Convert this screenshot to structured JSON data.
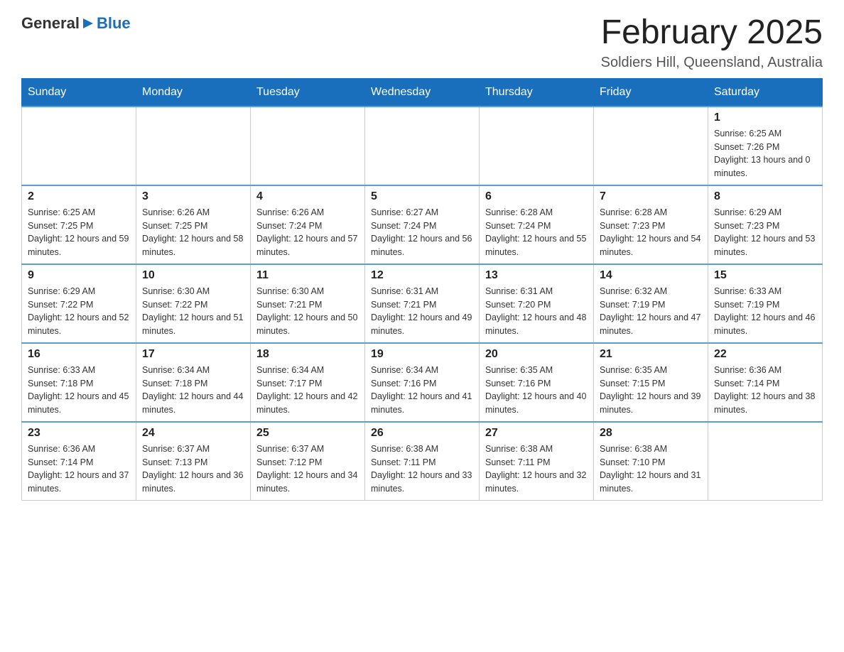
{
  "header": {
    "logo": {
      "general": "General",
      "arrow_symbol": "▶",
      "blue": "Blue"
    },
    "title": "February 2025",
    "location": "Soldiers Hill, Queensland, Australia"
  },
  "calendar": {
    "days_of_week": [
      "Sunday",
      "Monday",
      "Tuesday",
      "Wednesday",
      "Thursday",
      "Friday",
      "Saturday"
    ],
    "weeks": [
      {
        "days": [
          {
            "number": "",
            "info": ""
          },
          {
            "number": "",
            "info": ""
          },
          {
            "number": "",
            "info": ""
          },
          {
            "number": "",
            "info": ""
          },
          {
            "number": "",
            "info": ""
          },
          {
            "number": "",
            "info": ""
          },
          {
            "number": "1",
            "info": "Sunrise: 6:25 AM\nSunset: 7:26 PM\nDaylight: 13 hours and 0 minutes."
          }
        ]
      },
      {
        "days": [
          {
            "number": "2",
            "info": "Sunrise: 6:25 AM\nSunset: 7:25 PM\nDaylight: 12 hours and 59 minutes."
          },
          {
            "number": "3",
            "info": "Sunrise: 6:26 AM\nSunset: 7:25 PM\nDaylight: 12 hours and 58 minutes."
          },
          {
            "number": "4",
            "info": "Sunrise: 6:26 AM\nSunset: 7:24 PM\nDaylight: 12 hours and 57 minutes."
          },
          {
            "number": "5",
            "info": "Sunrise: 6:27 AM\nSunset: 7:24 PM\nDaylight: 12 hours and 56 minutes."
          },
          {
            "number": "6",
            "info": "Sunrise: 6:28 AM\nSunset: 7:24 PM\nDaylight: 12 hours and 55 minutes."
          },
          {
            "number": "7",
            "info": "Sunrise: 6:28 AM\nSunset: 7:23 PM\nDaylight: 12 hours and 54 minutes."
          },
          {
            "number": "8",
            "info": "Sunrise: 6:29 AM\nSunset: 7:23 PM\nDaylight: 12 hours and 53 minutes."
          }
        ]
      },
      {
        "days": [
          {
            "number": "9",
            "info": "Sunrise: 6:29 AM\nSunset: 7:22 PM\nDaylight: 12 hours and 52 minutes."
          },
          {
            "number": "10",
            "info": "Sunrise: 6:30 AM\nSunset: 7:22 PM\nDaylight: 12 hours and 51 minutes."
          },
          {
            "number": "11",
            "info": "Sunrise: 6:30 AM\nSunset: 7:21 PM\nDaylight: 12 hours and 50 minutes."
          },
          {
            "number": "12",
            "info": "Sunrise: 6:31 AM\nSunset: 7:21 PM\nDaylight: 12 hours and 49 minutes."
          },
          {
            "number": "13",
            "info": "Sunrise: 6:31 AM\nSunset: 7:20 PM\nDaylight: 12 hours and 48 minutes."
          },
          {
            "number": "14",
            "info": "Sunrise: 6:32 AM\nSunset: 7:19 PM\nDaylight: 12 hours and 47 minutes."
          },
          {
            "number": "15",
            "info": "Sunrise: 6:33 AM\nSunset: 7:19 PM\nDaylight: 12 hours and 46 minutes."
          }
        ]
      },
      {
        "days": [
          {
            "number": "16",
            "info": "Sunrise: 6:33 AM\nSunset: 7:18 PM\nDaylight: 12 hours and 45 minutes."
          },
          {
            "number": "17",
            "info": "Sunrise: 6:34 AM\nSunset: 7:18 PM\nDaylight: 12 hours and 44 minutes."
          },
          {
            "number": "18",
            "info": "Sunrise: 6:34 AM\nSunset: 7:17 PM\nDaylight: 12 hours and 42 minutes."
          },
          {
            "number": "19",
            "info": "Sunrise: 6:34 AM\nSunset: 7:16 PM\nDaylight: 12 hours and 41 minutes."
          },
          {
            "number": "20",
            "info": "Sunrise: 6:35 AM\nSunset: 7:16 PM\nDaylight: 12 hours and 40 minutes."
          },
          {
            "number": "21",
            "info": "Sunrise: 6:35 AM\nSunset: 7:15 PM\nDaylight: 12 hours and 39 minutes."
          },
          {
            "number": "22",
            "info": "Sunrise: 6:36 AM\nSunset: 7:14 PM\nDaylight: 12 hours and 38 minutes."
          }
        ]
      },
      {
        "days": [
          {
            "number": "23",
            "info": "Sunrise: 6:36 AM\nSunset: 7:14 PM\nDaylight: 12 hours and 37 minutes."
          },
          {
            "number": "24",
            "info": "Sunrise: 6:37 AM\nSunset: 7:13 PM\nDaylight: 12 hours and 36 minutes."
          },
          {
            "number": "25",
            "info": "Sunrise: 6:37 AM\nSunset: 7:12 PM\nDaylight: 12 hours and 34 minutes."
          },
          {
            "number": "26",
            "info": "Sunrise: 6:38 AM\nSunset: 7:11 PM\nDaylight: 12 hours and 33 minutes."
          },
          {
            "number": "27",
            "info": "Sunrise: 6:38 AM\nSunset: 7:11 PM\nDaylight: 12 hours and 32 minutes."
          },
          {
            "number": "28",
            "info": "Sunrise: 6:38 AM\nSunset: 7:10 PM\nDaylight: 12 hours and 31 minutes."
          },
          {
            "number": "",
            "info": ""
          }
        ]
      }
    ]
  }
}
